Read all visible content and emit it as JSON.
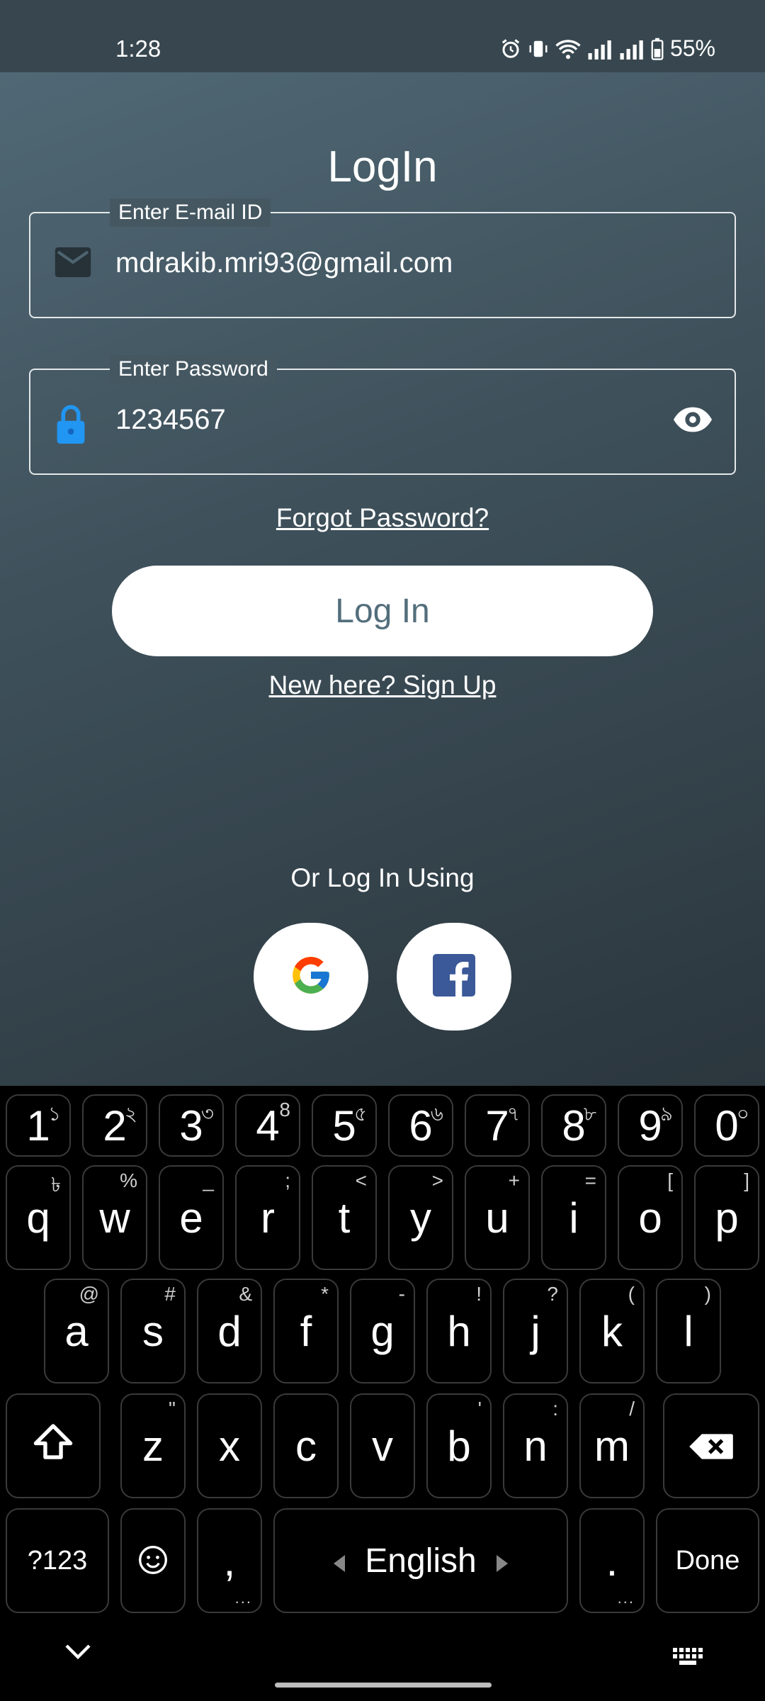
{
  "status_bar": {
    "time": "1:28",
    "battery": "55%"
  },
  "login": {
    "title": "LogIn",
    "email_legend": "Enter E-mail ID",
    "email_value": "mdrakib.mri93@gmail.com",
    "password_legend": "Enter Password",
    "password_value": "1234567",
    "forgot": "Forgot Password?",
    "login_button": "Log In",
    "signup": "New here? Sign Up",
    "or_label": "Or Log In Using"
  },
  "colors": {
    "accent_lock": "#2196f3",
    "facebook": "#3b5998",
    "button_text": "#536e7c"
  },
  "keyboard": {
    "row_numbers": [
      {
        "k": "1",
        "h": "১"
      },
      {
        "k": "2",
        "h": "২"
      },
      {
        "k": "3",
        "h": "৩"
      },
      {
        "k": "4",
        "h": "8"
      },
      {
        "k": "5",
        "h": "৫"
      },
      {
        "k": "6",
        "h": "৬"
      },
      {
        "k": "7",
        "h": "৭"
      },
      {
        "k": "8",
        "h": "৮"
      },
      {
        "k": "9",
        "h": "৯"
      },
      {
        "k": "0",
        "h": "০"
      }
    ],
    "row_q": [
      {
        "k": "q",
        "h": "৳"
      },
      {
        "k": "w",
        "h": "%"
      },
      {
        "k": "e",
        "h": "_"
      },
      {
        "k": "r",
        "h": ";"
      },
      {
        "k": "t",
        "h": "<"
      },
      {
        "k": "y",
        "h": ">"
      },
      {
        "k": "u",
        "h": "+"
      },
      {
        "k": "i",
        "h": "="
      },
      {
        "k": "o",
        "h": "["
      },
      {
        "k": "p",
        "h": "]"
      }
    ],
    "row_a": [
      {
        "k": "a",
        "h": "@"
      },
      {
        "k": "s",
        "h": "#"
      },
      {
        "k": "d",
        "h": "&"
      },
      {
        "k": "f",
        "h": "*"
      },
      {
        "k": "g",
        "h": "-"
      },
      {
        "k": "h",
        "h": "!"
      },
      {
        "k": "j",
        "h": "?"
      },
      {
        "k": "k",
        "h": "("
      },
      {
        "k": "l",
        "h": ")"
      }
    ],
    "row_z": [
      {
        "k": "z",
        "h": "\""
      },
      {
        "k": "x",
        "h": ""
      },
      {
        "k": "c",
        "h": ""
      },
      {
        "k": "v",
        "h": ""
      },
      {
        "k": "b",
        "h": "'"
      },
      {
        "k": "n",
        "h": ":"
      },
      {
        "k": "m",
        "h": "/"
      }
    ],
    "symbols_key": "?123",
    "comma_key": ",",
    "space_label": "English",
    "period_key": ".",
    "done_key": "Done"
  }
}
